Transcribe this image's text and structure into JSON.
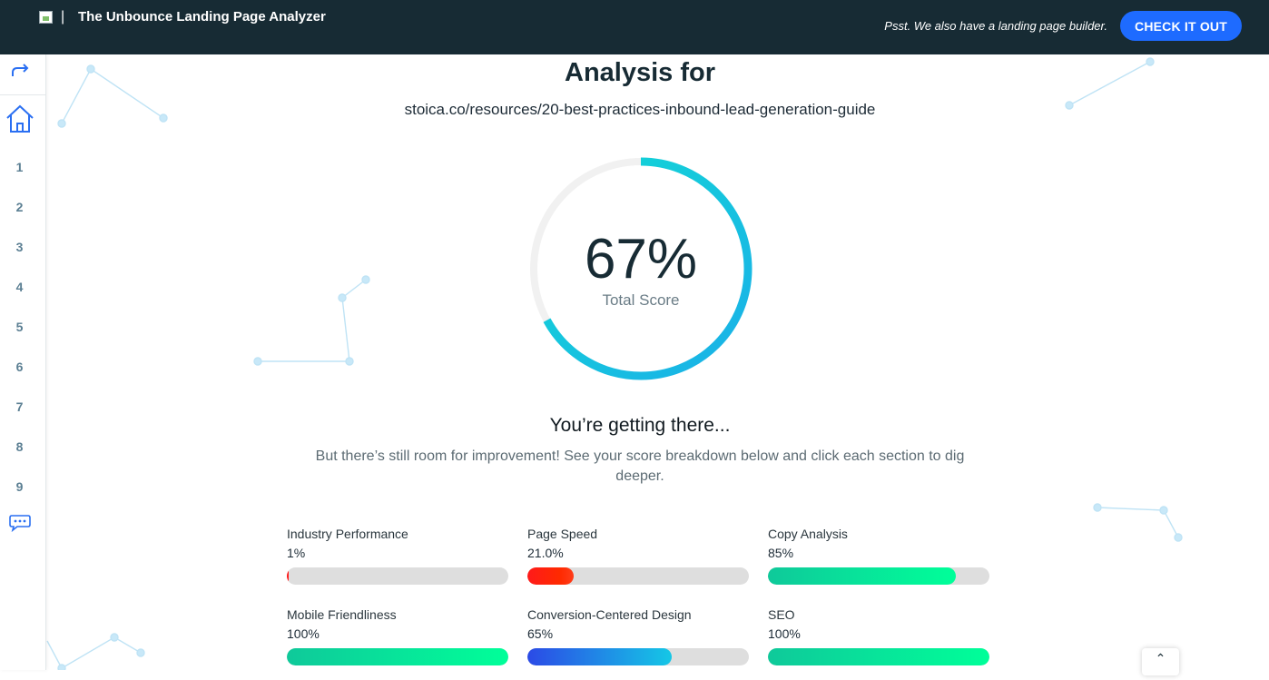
{
  "header": {
    "title": "The Unbounce Landing Page Analyzer",
    "separator": "|",
    "promo_text": "Psst. We also have a landing page builder.",
    "cta_label": "CHECK IT OUT",
    "logo_icon": "broken-image-icon"
  },
  "sidebar": {
    "share_icon": "share-arrow-icon",
    "home_icon": "home-icon",
    "sections": [
      "1",
      "2",
      "3",
      "4",
      "5",
      "6",
      "7",
      "8",
      "9"
    ],
    "chat_icon": "chat-icon"
  },
  "analysis": {
    "heading": "Analysis for",
    "url": "stoica.co/resources/20-best-practices-inbound-lead-generation-guide",
    "total_score_text": "67%",
    "total_score_fraction": 0.67,
    "total_score_label": "Total Score",
    "verdict": "You’re getting there...",
    "description": "But there’s still room for improvement! See your score breakdown below and click each section to dig deeper."
  },
  "metrics": [
    {
      "name": "Industry Performance",
      "value": "1%",
      "fraction": 0.01,
      "color": "red"
    },
    {
      "name": "Page Speed",
      "value": "21.0%",
      "fraction": 0.21,
      "color": "red"
    },
    {
      "name": "Copy Analysis",
      "value": "85%",
      "fraction": 0.85,
      "color": "green"
    },
    {
      "name": "Mobile Friendliness",
      "value": "100%",
      "fraction": 1.0,
      "color": "green"
    },
    {
      "name": "Conversion-Centered Design",
      "value": "65%",
      "fraction": 0.65,
      "color": "blue"
    },
    {
      "name": "SEO",
      "value": "100%",
      "fraction": 1.0,
      "color": "green"
    }
  ],
  "colors": {
    "topbar": "#172b34",
    "cta": "#1e6bff",
    "gauge_start": "#1ab0e8",
    "gauge_end": "#12d9d4",
    "green_start": "#0fc99a",
    "green_end": "#00ff99",
    "red_start": "#ff1a1a",
    "blue_start": "#2b4ae6",
    "blue_end": "#15c7e6"
  },
  "scroll_top_icon": "chevron-up-icon",
  "scroll_top_glyph": "⌃"
}
